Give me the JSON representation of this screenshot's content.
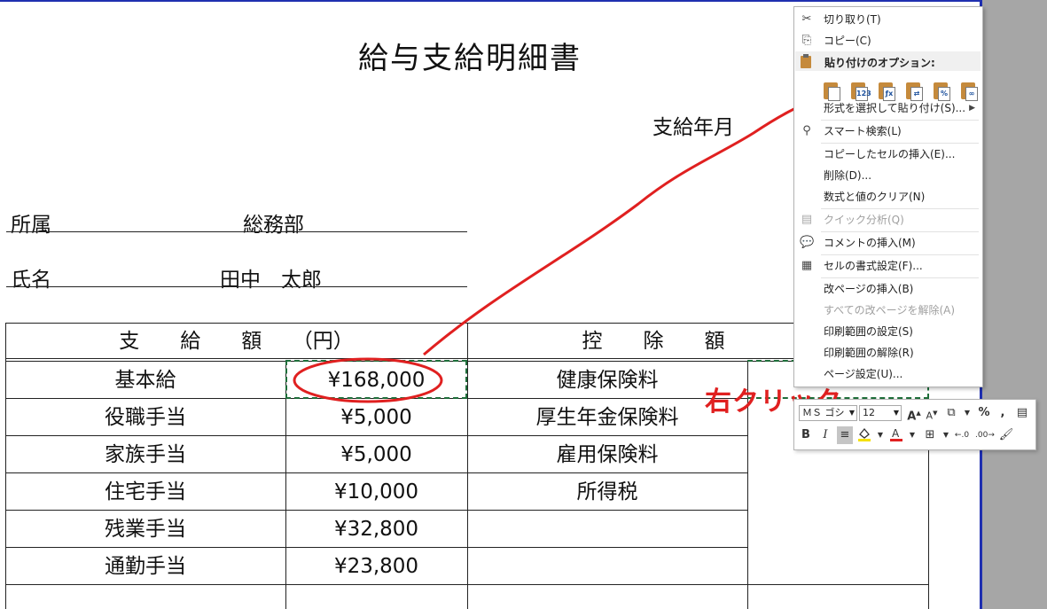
{
  "document": {
    "title": "給与支給明細書",
    "pay_month_label": "支給年月",
    "department_label": "所属",
    "department_value": "総務部",
    "name_label": "氏名",
    "name_value": "田中　太郎"
  },
  "table": {
    "pay_header": "支　　給　　額　　（円）",
    "deduction_header": "控　　除　　額",
    "pay_items": [
      {
        "label": "基本給",
        "amount": "¥168,000"
      },
      {
        "label": "役職手当",
        "amount": "¥5,000"
      },
      {
        "label": "家族手当",
        "amount": "¥5,000"
      },
      {
        "label": "住宅手当",
        "amount": "¥10,000"
      },
      {
        "label": "残業手当",
        "amount": "¥32,800"
      },
      {
        "label": "通勤手当",
        "amount": "¥23,800"
      }
    ],
    "deduction_items": [
      "健康保険料",
      "厚生年金保険料",
      "雇用保険料",
      "所得税"
    ]
  },
  "annotation": {
    "text": "右クリック",
    "color": "#e02020"
  },
  "context_menu": {
    "cut": "切り取り(T)",
    "copy": "コピー(C)",
    "paste_options_header": "貼り付けのオプション:",
    "paste_values_badge": "123",
    "paste_special": "形式を選択して貼り付け(S)...",
    "smart_lookup": "スマート検索(L)",
    "insert_copied_cells": "コピーしたセルの挿入(E)...",
    "delete": "削除(D)...",
    "clear_contents": "数式と値のクリア(N)",
    "quick_analysis": "クイック分析(Q)",
    "insert_comment": "コメントの挿入(M)",
    "format_cells": "セルの書式設定(F)...",
    "insert_page_break": "改ページの挿入(B)",
    "reset_page_breaks": "すべての改ページを解除(A)",
    "set_print_area": "印刷範囲の設定(S)",
    "clear_print_area": "印刷範囲の解除(R)",
    "page_setup": "ページ設定(U)..."
  },
  "mini_toolbar": {
    "font_name": "ＭＳ ゴシ",
    "font_size": "12",
    "bold": "B",
    "italic": "I",
    "percent": "%",
    "comma": ","
  },
  "colors": {
    "page_border": "#1f2fb0",
    "selection_border": "#1e6e3a",
    "annotation_red": "#e02020",
    "margin_gray": "#a6a6a6"
  }
}
